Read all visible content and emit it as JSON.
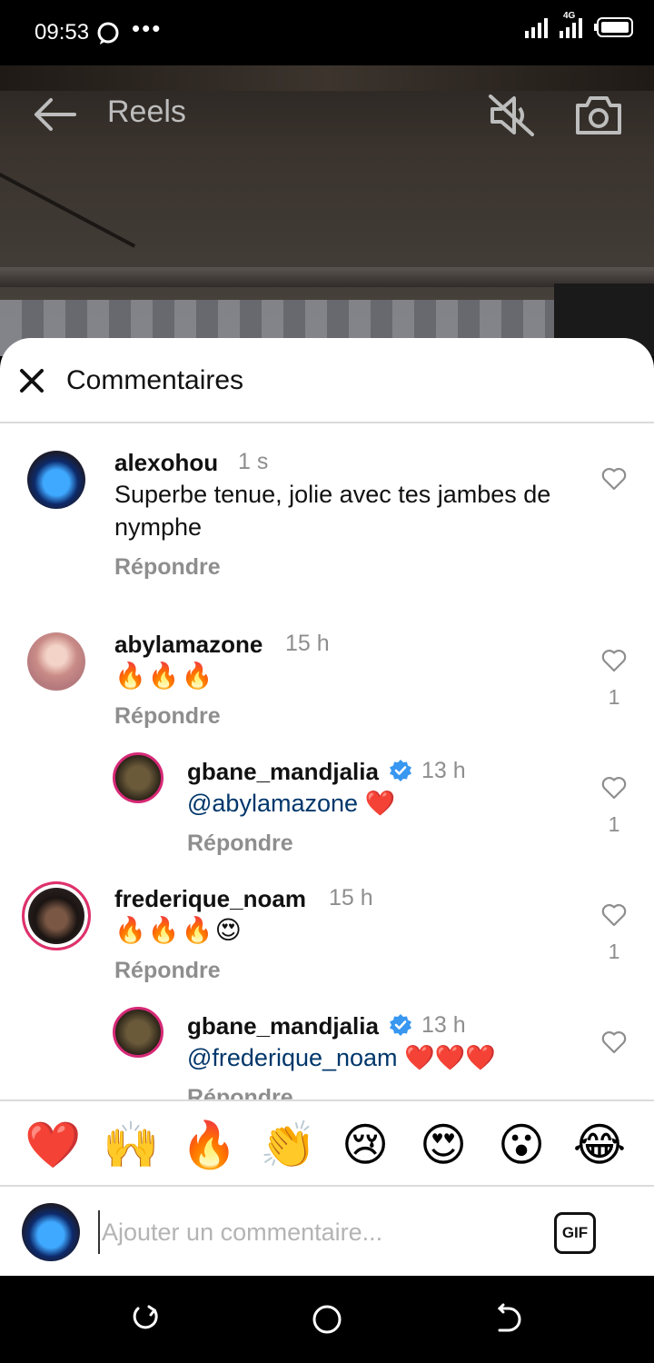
{
  "status_bar": {
    "time": "09:53",
    "dots": "•••",
    "network": "4G"
  },
  "topbar": {
    "title": "Reels",
    "icons": [
      "back-arrow-icon",
      "muted-speaker-icon",
      "camera-icon"
    ]
  },
  "sheet": {
    "title": "Commentaires",
    "reply_label": "Répondre"
  },
  "comments": [
    {
      "username": "alexohou",
      "time": "1 s",
      "text_line1": "Superbe tenue, jolie avec tes jambes de",
      "text_line2": "nymphe",
      "likes": ""
    },
    {
      "username": "abylamazone",
      "time": "15 h",
      "text": "🔥🔥🔥",
      "likes": "1"
    },
    {
      "username": "gbane_mandjalia",
      "verified": true,
      "time": "13 h",
      "mention": "@abylamazone",
      "text": "❤️",
      "likes": "1"
    },
    {
      "username": "frederique_noam",
      "time": "15 h",
      "text": "🔥🔥🔥😍",
      "likes": "1"
    },
    {
      "username": "gbane_mandjalia",
      "verified": true,
      "time": "13 h",
      "mention": "@frederique_noam",
      "text": "❤️❤️❤️",
      "likes": ""
    }
  ],
  "reactions": [
    "❤️",
    "🙌",
    "🔥",
    "👏",
    "😢",
    "😍",
    "😮",
    "😂"
  ],
  "composer": {
    "placeholder": "Ajouter un commentaire...",
    "gif_label": "GIF"
  },
  "colors": {
    "mention": "#00376b",
    "verified": "#3897f0",
    "muted_text": "#8e8e8e"
  }
}
